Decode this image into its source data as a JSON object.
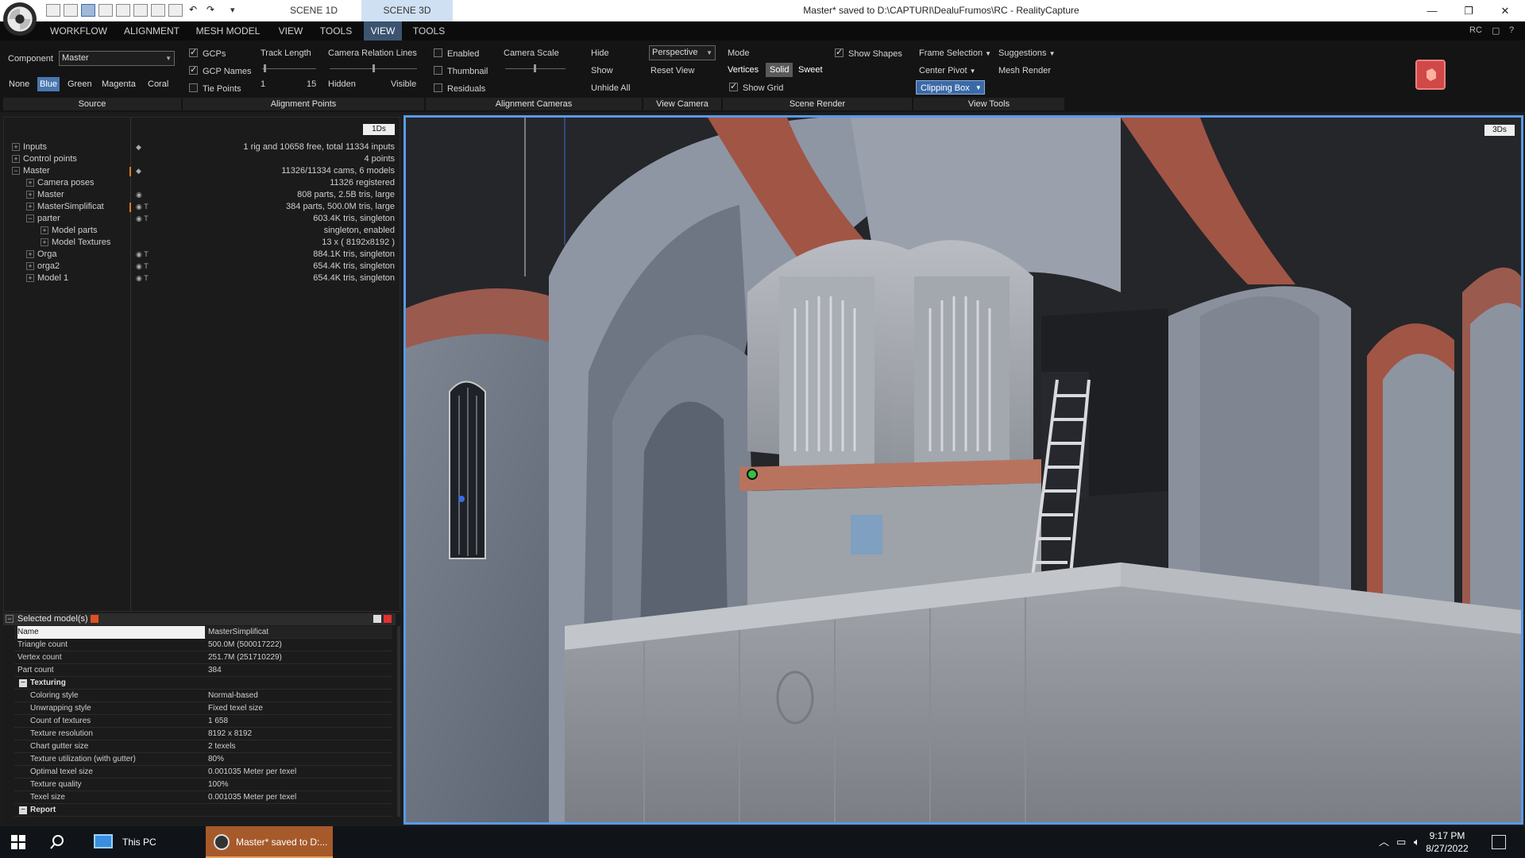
{
  "titlebar": {
    "scene_1d": "SCENE 1D",
    "scene_3d": "SCENE 3D",
    "title": "Master* saved to D:\\CAPTURI\\DealuFrumos\\RC - RealityCapture",
    "qat_drop": "▾",
    "min": "—",
    "max": "❐",
    "close": "✕"
  },
  "menu": {
    "items": [
      "WORKFLOW",
      "ALIGNMENT",
      "MESH MODEL",
      "VIEW",
      "TOOLS",
      "VIEW",
      "TOOLS"
    ],
    "right": [
      "RC",
      "▢",
      "?"
    ]
  },
  "ribbon": {
    "component_label": "Component",
    "component_value": "Master",
    "colors": [
      "None",
      "Blue",
      "Green",
      "Magenta",
      "Coral"
    ],
    "source_label": "Source",
    "gcps": "GCPs",
    "gcp_names": "GCP Names",
    "tie_points": "Tie Points",
    "track_length": "Track Length",
    "track_min": "1",
    "track_max": "15",
    "camera_relation_lines": "Camera Relation Lines",
    "hidden": "Hidden",
    "visible": "Visible",
    "alignment_points_label": "Alignment Points",
    "enabled": "Enabled",
    "thumbnail": "Thumbnail",
    "residuals": "Residuals",
    "camera_scale": "Camera Scale",
    "hide": "Hide",
    "show": "Show",
    "unhide_all": "Unhide All",
    "alignment_cameras_label": "Alignment Cameras",
    "projection": "Perspective",
    "reset_view": "Reset View",
    "view_camera_label": "View Camera",
    "mode": "Mode",
    "vertices": "Vertices",
    "solid": "Solid",
    "sweet": "Sweet",
    "show_shapes": "Show Shapes",
    "show_grid": "Show Grid",
    "scene_render_label": "Scene Render",
    "frame_selection": "Frame Selection",
    "suggestions": "Suggestions",
    "center_pivot": "Center Pivot",
    "mesh_render": "Mesh Render",
    "clipping_box": "Clipping Box",
    "view_tools_label": "View Tools"
  },
  "tree": {
    "badge": "1Ds",
    "rows": [
      {
        "label": "Inputs",
        "value": "1 rig and 10658 free, total 11334 inputs"
      },
      {
        "label": "Control points",
        "value": "4 points"
      },
      {
        "label": "Master",
        "value": "11326/11334 cams, 6 models"
      },
      {
        "label": "Camera poses",
        "value": "11326 registered"
      },
      {
        "label": "Master",
        "value": "808 parts, 2.5B tris, large"
      },
      {
        "label": "MasterSimplificat",
        "value": "384 parts, 500.0M tris, large"
      },
      {
        "label": "parter",
        "value": "603.4K tris, singleton"
      },
      {
        "label": "Model parts",
        "value": "singleton, enabled"
      },
      {
        "label": "Model Textures",
        "value": "13 x ( 8192x8192 )"
      },
      {
        "label": "Orga",
        "value": "884.1K tris, singleton"
      },
      {
        "label": "orga2",
        "value": "654.4K tris, singleton"
      },
      {
        "label": "Model 1",
        "value": "654.4K tris, singleton"
      }
    ]
  },
  "properties": {
    "header": "Selected model(s)",
    "rows": [
      {
        "k": "Name",
        "v": "MasterSimplificat"
      },
      {
        "k": "Triangle count",
        "v": "500.0M (500017222)"
      },
      {
        "k": "Vertex count",
        "v": "251.7M (251710229)"
      },
      {
        "k": "Part count",
        "v": "384"
      },
      {
        "k": "Texturing",
        "v": ""
      },
      {
        "k": "Coloring style",
        "v": "Normal-based"
      },
      {
        "k": "Unwrapping style",
        "v": "Fixed texel size"
      },
      {
        "k": "Count of textures",
        "v": "1 658"
      },
      {
        "k": "Texture resolution",
        "v": "8192 x 8192"
      },
      {
        "k": "Chart gutter size",
        "v": "2 texels"
      },
      {
        "k": "Texture utilization (with gutter)",
        "v": "80%"
      },
      {
        "k": "Optimal texel size",
        "v": "0.001035 Meter per texel"
      },
      {
        "k": "Texture quality",
        "v": "100%"
      },
      {
        "k": "Texel size",
        "v": "0.001035 Meter per texel"
      },
      {
        "k": "Report",
        "v": ""
      }
    ]
  },
  "viewport": {
    "badge": "3Ds"
  },
  "taskbar": {
    "this_pc": "This PC",
    "rc_window": "Master* saved to D:...",
    "time": "9:17 PM",
    "date": "8/27/2022"
  }
}
